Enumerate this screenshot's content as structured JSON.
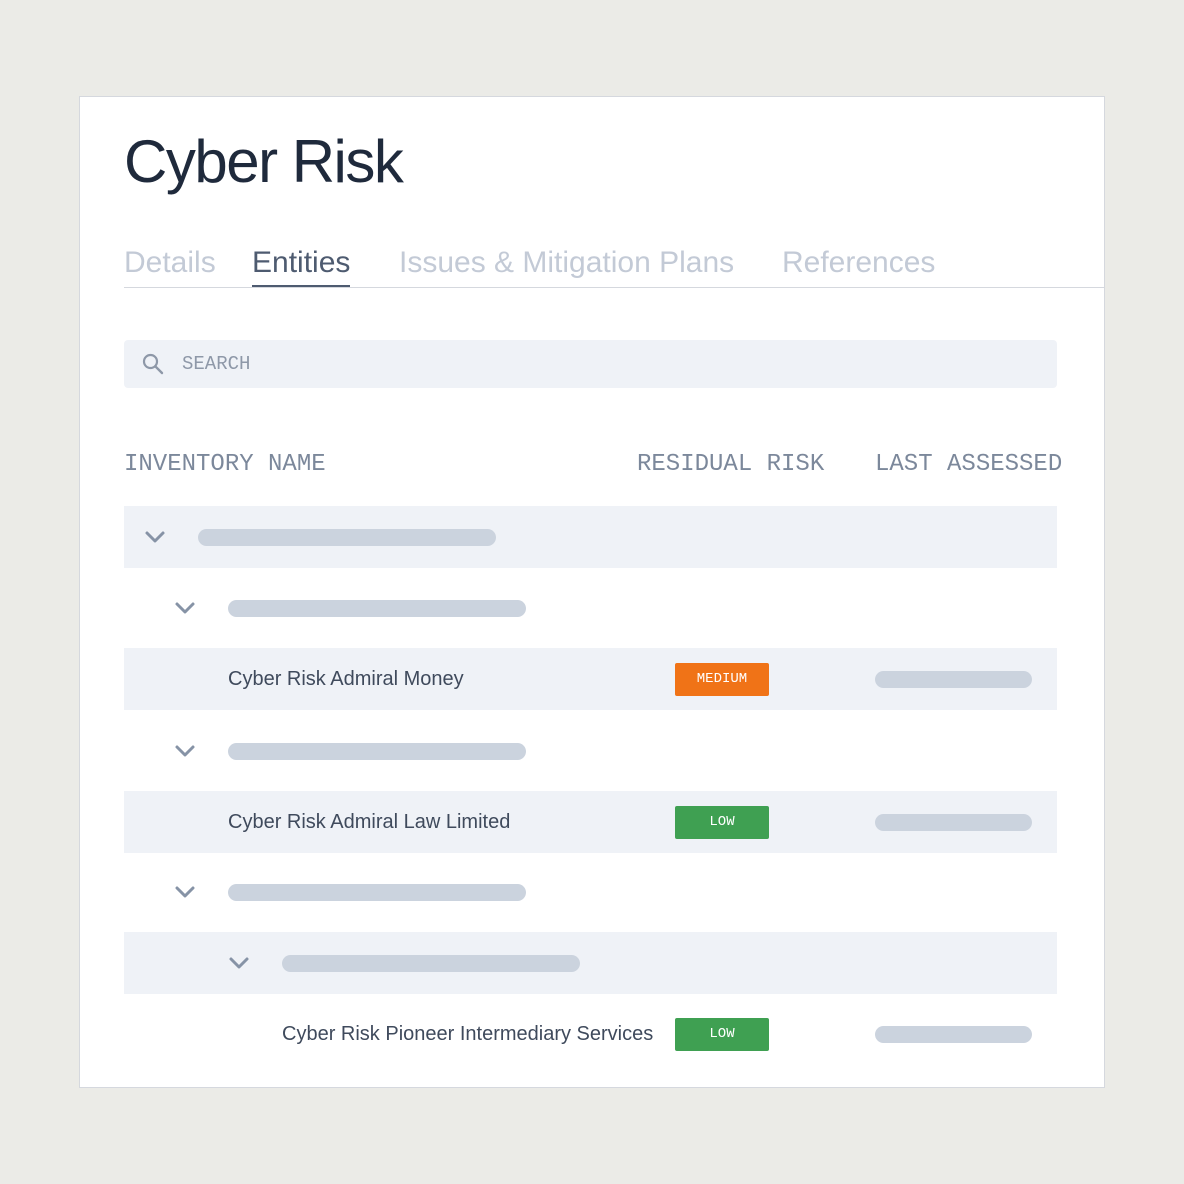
{
  "page": {
    "title": "Cyber Risk"
  },
  "tabs": [
    {
      "label": "Details",
      "active": false
    },
    {
      "label": "Entities",
      "active": true
    },
    {
      "label": "Issues & Mitigation Plans",
      "active": false
    },
    {
      "label": "References",
      "active": false
    }
  ],
  "search": {
    "placeholder": "SEARCH",
    "icon": "search-icon"
  },
  "table": {
    "columns": [
      "INVENTORY NAME",
      "RESIDUAL RISK",
      "LAST ASSESSED"
    ],
    "rows": [
      {
        "type": "group",
        "level": 0,
        "expanded": true
      },
      {
        "type": "group",
        "level": 1,
        "expanded": true
      },
      {
        "type": "entity",
        "level": 2,
        "name": "Cyber Risk Admiral Money",
        "risk": "MEDIUM"
      },
      {
        "type": "group",
        "level": 1,
        "expanded": true
      },
      {
        "type": "entity",
        "level": 2,
        "name": "Cyber Risk Admiral Law Limited",
        "risk": "LOW"
      },
      {
        "type": "group",
        "level": 1,
        "expanded": true
      },
      {
        "type": "group",
        "level": 2,
        "expanded": true
      },
      {
        "type": "entity",
        "level": 3,
        "name": "Cyber Risk Pioneer Intermediary Services",
        "risk": "LOW"
      }
    ]
  },
  "colors": {
    "risk_medium": "#f07317",
    "risk_low": "#3fa052",
    "accent_tab": "#4e5b70",
    "row_shade": "#eff2f7"
  }
}
